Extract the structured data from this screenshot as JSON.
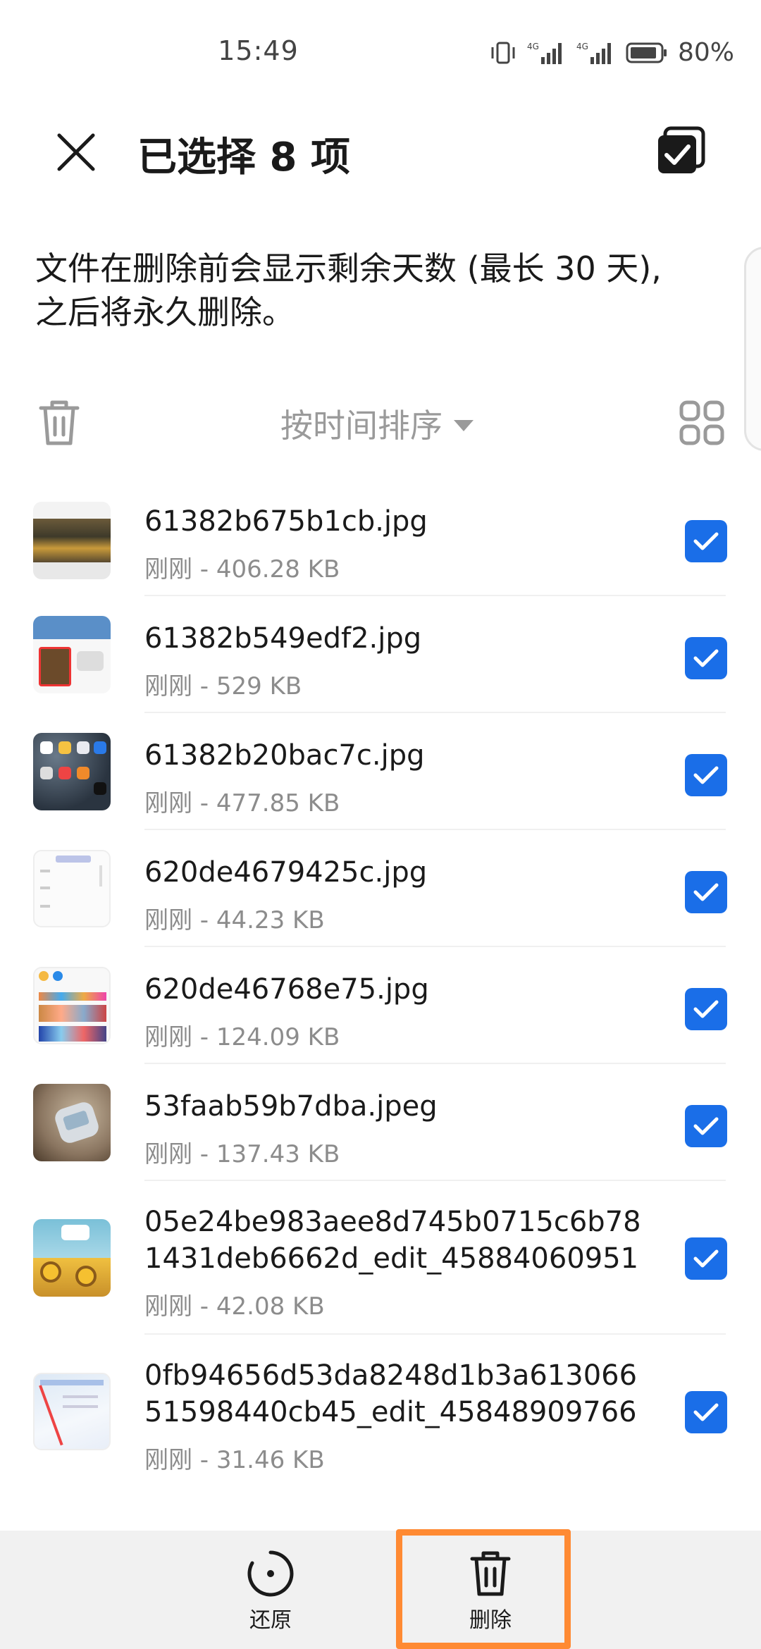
{
  "status_bar": {
    "time": "15:49",
    "network_1": "4G",
    "network_2": "4G",
    "battery": "80%"
  },
  "header": {
    "title": "已选择 8 项",
    "close_icon": "close-icon",
    "select_all_icon": "select-all-checkbox-icon"
  },
  "notice": {
    "line1": "文件在删除前会显示剩余天数 (最长 30 天),",
    "line2": "之后将永久删除。"
  },
  "toolbar": {
    "sort_label": "按时间排序",
    "trash_icon": "trash-icon",
    "grid_icon": "grid-view-icon"
  },
  "files": [
    {
      "name": "61382b675b1cb.jpg",
      "meta": "刚刚 - 406.28 KB",
      "checked": true
    },
    {
      "name": "61382b549edf2.jpg",
      "meta": "刚刚 - 529 KB",
      "checked": true
    },
    {
      "name": "61382b20bac7c.jpg",
      "meta": "刚刚 - 477.85 KB",
      "checked": true
    },
    {
      "name": "620de4679425c.jpg",
      "meta": "刚刚 - 44.23 KB",
      "checked": true
    },
    {
      "name": "620de46768e75.jpg",
      "meta": "刚刚 - 124.09 KB",
      "checked": true
    },
    {
      "name": "53faab59b7dba.jpeg",
      "meta": "刚刚 - 137.43 KB",
      "checked": true
    },
    {
      "name": "05e24be983aee8d745b0715c6b781431deb6662d_edit_458840609518...",
      "meta": "刚刚 - 42.08 KB",
      "checked": true
    },
    {
      "name": "0fb94656d53da8248d1b3a61306651598440cb45_edit_458489097660...",
      "meta": "刚刚 - 31.46 KB",
      "checked": true
    }
  ],
  "bottom_bar": {
    "restore_label": "还原",
    "delete_label": "删除",
    "highlight_color": "#ff8a33"
  },
  "colors": {
    "accent": "#1a6ee8",
    "muted_text": "#8c8c8c"
  }
}
